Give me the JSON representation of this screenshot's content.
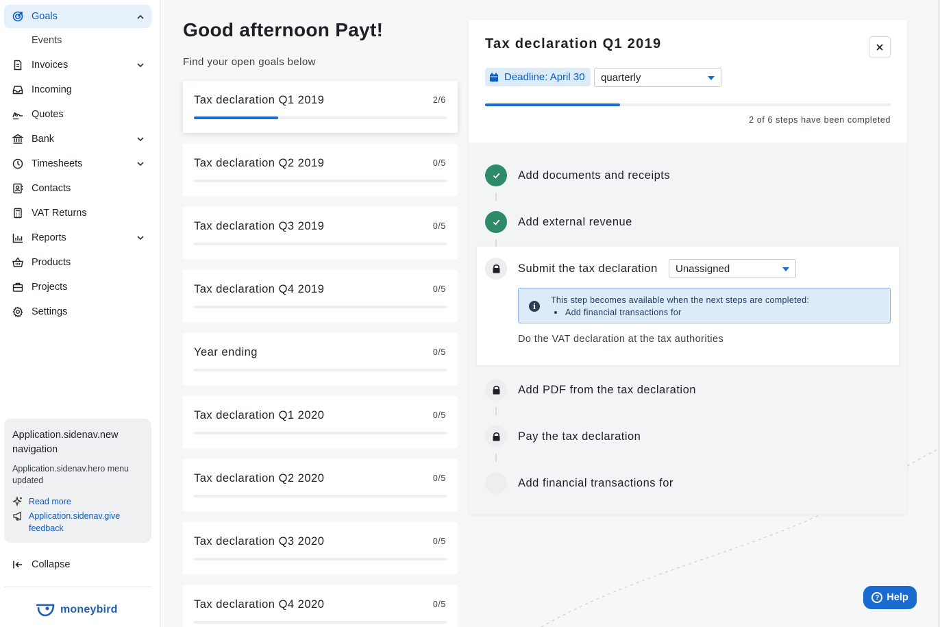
{
  "sidebar": {
    "items": [
      {
        "label": "Goals",
        "icon": "target-icon",
        "expandable": true,
        "expanded": true,
        "active": true
      },
      {
        "label": "Events",
        "sub": true
      },
      {
        "label": "Invoices",
        "icon": "document-icon",
        "expandable": true
      },
      {
        "label": "Incoming",
        "icon": "inbox-icon"
      },
      {
        "label": "Quotes",
        "icon": "signature-icon"
      },
      {
        "label": "Bank",
        "icon": "bank-icon",
        "expandable": true
      },
      {
        "label": "Timesheets",
        "icon": "clock-icon",
        "expandable": true
      },
      {
        "label": "Contacts",
        "icon": "contacts-icon"
      },
      {
        "label": "VAT Returns",
        "icon": "calculator-icon"
      },
      {
        "label": "Reports",
        "icon": "bar-chart-icon",
        "expandable": true
      },
      {
        "label": "Products",
        "icon": "basket-icon"
      },
      {
        "label": "Projects",
        "icon": "briefcase-icon"
      },
      {
        "label": "Settings",
        "icon": "gear-icon"
      }
    ],
    "promo": {
      "title": "Application.sidenav.new navigation",
      "text": "Application.sidenav.hero menu updated",
      "read_more": "Read more",
      "feedback": "Application.sidenav.give feedback"
    },
    "collapse_label": "Collapse",
    "logo_text": "moneybird"
  },
  "main": {
    "greeting": "Good afternoon Payt!",
    "subtitle": "Find your open goals below",
    "goals": [
      {
        "name": "Tax declaration Q1 2019",
        "count": "2/6",
        "progress": 0.333,
        "selected": true
      },
      {
        "name": "Tax declaration Q2 2019",
        "count": "0/5",
        "progress": 0
      },
      {
        "name": "Tax declaration Q3 2019",
        "count": "0/5",
        "progress": 0
      },
      {
        "name": "Tax declaration Q4 2019",
        "count": "0/5",
        "progress": 0
      },
      {
        "name": "Year ending",
        "count": "0/5",
        "progress": 0
      },
      {
        "name": "Tax declaration Q1 2020",
        "count": "0/5",
        "progress": 0
      },
      {
        "name": "Tax declaration Q2 2020",
        "count": "0/5",
        "progress": 0
      },
      {
        "name": "Tax declaration Q3 2020",
        "count": "0/5",
        "progress": 0
      },
      {
        "name": "Tax declaration Q4 2020",
        "count": "0/5",
        "progress": 0
      }
    ]
  },
  "detail": {
    "title": "Tax declaration Q1 2019",
    "deadline": "Deadline: April 30",
    "frequency": "quarterly",
    "progress": 0.333,
    "progress_text": "2 of 6 steps have been completed",
    "steps": [
      {
        "label": "Add documents and receipts",
        "status": "done"
      },
      {
        "label": "Add external revenue",
        "status": "done"
      },
      {
        "label": "Submit the tax declaration",
        "status": "locked",
        "assignee": "Unassigned",
        "info": "This step becomes available when the next steps are completed:",
        "info_item": "Add financial transactions for",
        "description": "Do the VAT declaration at the tax authorities"
      },
      {
        "label": "Add PDF from the tax declaration",
        "status": "locked"
      },
      {
        "label": "Pay the tax declaration",
        "status": "locked"
      },
      {
        "label": "Add financial transactions for",
        "status": "empty"
      }
    ]
  },
  "help_label": "Help",
  "colors": {
    "accent": "#1a6bd0",
    "success": "#2e8b68",
    "active_bg": "#e6f0fb"
  }
}
